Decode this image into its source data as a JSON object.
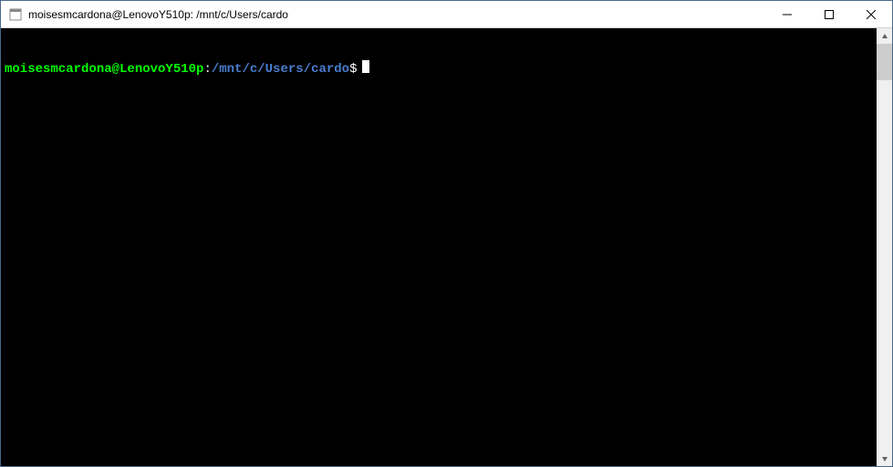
{
  "window": {
    "title": "moisesmcardona@LenovoY510p: /mnt/c/Users/cardo"
  },
  "terminal": {
    "prompt": {
      "userhost": "moisesmcardona@LenovoY510p",
      "separator": ":",
      "path": "/mnt/c/Users/cardo",
      "symbol": "$"
    },
    "input": ""
  },
  "colors": {
    "prompt_user": "#00ff00",
    "prompt_path": "#4a7ecf",
    "background": "#000000",
    "foreground": "#ffffff"
  }
}
